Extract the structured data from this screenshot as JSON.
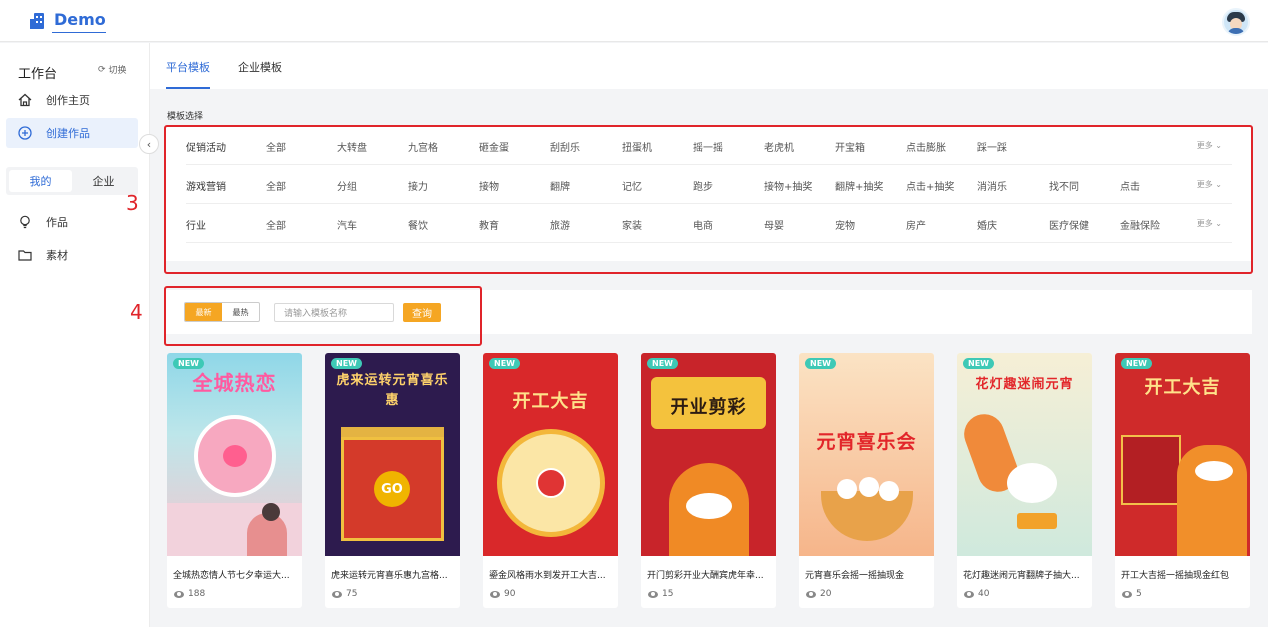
{
  "app": {
    "logo_text": "Demo"
  },
  "sidebar": {
    "workspace_title": "工作台",
    "switch_label": "切换",
    "items": [
      {
        "label": "创作主页",
        "icon": "home-icon"
      },
      {
        "label": "创建作品",
        "icon": "plus-circle-icon"
      }
    ],
    "scope_tabs": [
      "我的",
      "企业"
    ],
    "items2": [
      {
        "label": "作品",
        "icon": "bulb-icon"
      },
      {
        "label": "素材",
        "icon": "folder-icon"
      }
    ]
  },
  "main": {
    "tabs": [
      "平台模板",
      "企业模板"
    ],
    "section_label": "模板选择",
    "filters": [
      {
        "name": "促销活动",
        "options": [
          "全部",
          "大转盘",
          "九宫格",
          "砸金蛋",
          "刮刮乐",
          "扭蛋机",
          "摇一摇",
          "老虎机",
          "开宝箱",
          "点击膨胀",
          "踩一踩"
        ],
        "more": "更多"
      },
      {
        "name": "游戏营销",
        "options": [
          "全部",
          "分组",
          "接力",
          "接物",
          "翻牌",
          "记忆",
          "跑步",
          "接物+抽奖",
          "翻牌+抽奖",
          "点击+抽奖",
          "消消乐",
          "找不同",
          "点击"
        ],
        "more": "更多"
      },
      {
        "name": "行业",
        "options": [
          "全部",
          "汽车",
          "餐饮",
          "教育",
          "旅游",
          "家装",
          "电商",
          "母婴",
          "宠物",
          "房产",
          "婚庆",
          "医疗保健",
          "金融保险"
        ],
        "more": "更多"
      }
    ],
    "sort": [
      "最新",
      "最热"
    ],
    "search_placeholder": "请输入模板名称",
    "search_button": "查询",
    "annotations": [
      "3",
      "4"
    ],
    "badge_new": "NEW",
    "cards": [
      {
        "title": "全城热恋情人节七夕幸运大...",
        "views": "188",
        "poster_text": "全城热恋"
      },
      {
        "title": "虎来运转元宵喜乐惠九宫格...",
        "views": "75",
        "poster_text": "虎来运转元宵喜乐惠"
      },
      {
        "title": "鎏金风格雨水到发开工大吉...",
        "views": "90",
        "poster_text": "开工大吉"
      },
      {
        "title": "开门剪彩开业大酬宾虎年幸...",
        "views": "15",
        "poster_text": "开业剪彩"
      },
      {
        "title": "元宵喜乐会摇一摇抽现金",
        "views": "20",
        "poster_text": "元宵喜乐会"
      },
      {
        "title": "花灯趣迷闹元宵翻牌子抽大...",
        "views": "40",
        "poster_text": "花灯趣迷闹元宵"
      },
      {
        "title": "开工大吉摇一摇抽现金红包",
        "views": "5",
        "poster_text": "开工大吉"
      }
    ]
  },
  "colors": {
    "accent": "#2f6bd6",
    "orange": "#f5a623",
    "annotation_red": "#e0242a"
  }
}
